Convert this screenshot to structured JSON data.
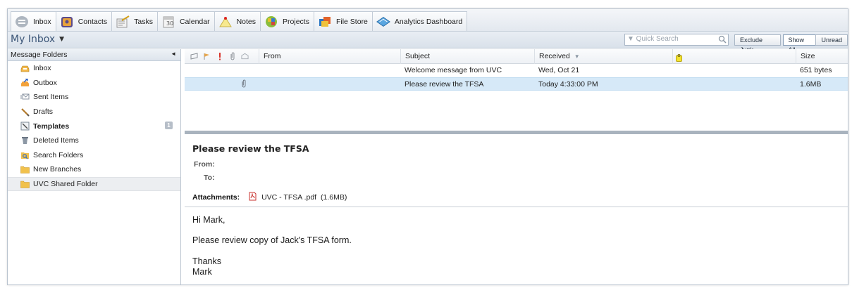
{
  "tabs": [
    {
      "label": "Inbox"
    },
    {
      "label": "Contacts"
    },
    {
      "label": "Tasks"
    },
    {
      "label": "Calendar"
    },
    {
      "label": "Notes"
    },
    {
      "label": "Projects"
    },
    {
      "label": "File Store"
    },
    {
      "label": "Analytics Dashboard"
    }
  ],
  "header": {
    "title": "My Inbox",
    "search_placeholder": "▼ Quick Search",
    "filters": {
      "exclude_junk": "Exclude Junk",
      "show_all": "Show All",
      "unread": "Unread"
    }
  },
  "sidebar": {
    "title": "Message Folders",
    "items": [
      {
        "label": "Inbox"
      },
      {
        "label": "Outbox"
      },
      {
        "label": "Sent Items"
      },
      {
        "label": "Drafts"
      },
      {
        "label": "Templates",
        "badge": "1"
      },
      {
        "label": "Deleted Items"
      },
      {
        "label": "Search Folders"
      },
      {
        "label": "New Branches"
      },
      {
        "label": "UVC Shared Folder"
      }
    ]
  },
  "list": {
    "columns": {
      "from": "From",
      "subject": "Subject",
      "received": "Received",
      "size": "Size"
    },
    "rows": [
      {
        "from": "",
        "subject": "Welcome message from UVC",
        "received": "Wed, Oct 21",
        "size": "651 bytes"
      },
      {
        "from": "",
        "subject": "Please review the TFSA",
        "received": "Today 4:33:00 PM",
        "size": "1.6MB"
      }
    ]
  },
  "reader": {
    "subject": "Please review the TFSA",
    "from_label": "From:",
    "to_label": "To:",
    "attachments_label": "Attachments:",
    "attachment_name": "UVC - TFSA .pdf",
    "attachment_size": "(1.6MB)",
    "greeting": "Hi Mark,",
    "body": "Please review copy of Jack's TFSA form.",
    "closing": "Thanks",
    "signature": "Mark"
  },
  "colors": {
    "accent": "#3b5577",
    "selected_row": "#d6e9f8",
    "splitter": "#a9b3be"
  }
}
